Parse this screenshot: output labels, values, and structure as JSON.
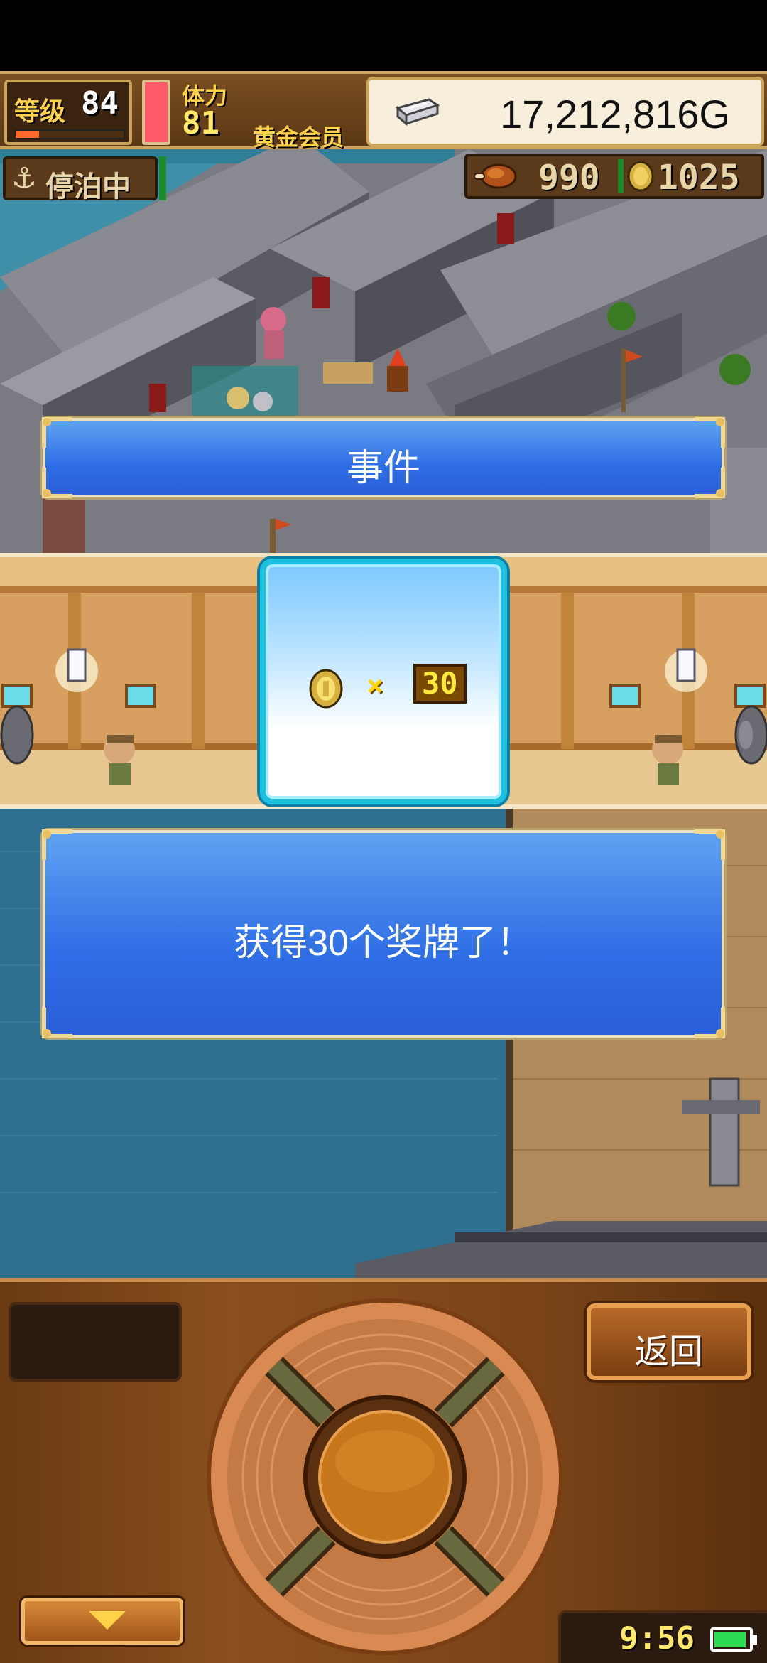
{
  "hud": {
    "level_label": "等级",
    "level": "84",
    "level_progress": 0.22,
    "stamina_label": "体力",
    "stamina": "81",
    "stamina_fill": 1.0,
    "membership": "黄金会员",
    "gold": "17,212,816G"
  },
  "status": {
    "dock_label": "停泊中",
    "food": "990",
    "medals": "1025"
  },
  "event": {
    "title": "事件"
  },
  "reward": {
    "times_symbol": "×",
    "quantity": "30"
  },
  "message": {
    "text": "获得30个奖牌了！"
  },
  "controller": {
    "back_label": "返回",
    "clock": "9:56",
    "battery_level": 0.85
  },
  "colors": {
    "banner_blue": "#2f6ee6",
    "reward_border": "#1ec0e0",
    "controller_wood": "#8a4f1e",
    "gold_text": "#ffd34a"
  },
  "icons": {
    "gold": "silver-ingot-icon",
    "food": "roast-meat-icon",
    "medal": "medal-coin-icon",
    "dock": "anchor-icon",
    "down": "down-arrow-icon"
  }
}
